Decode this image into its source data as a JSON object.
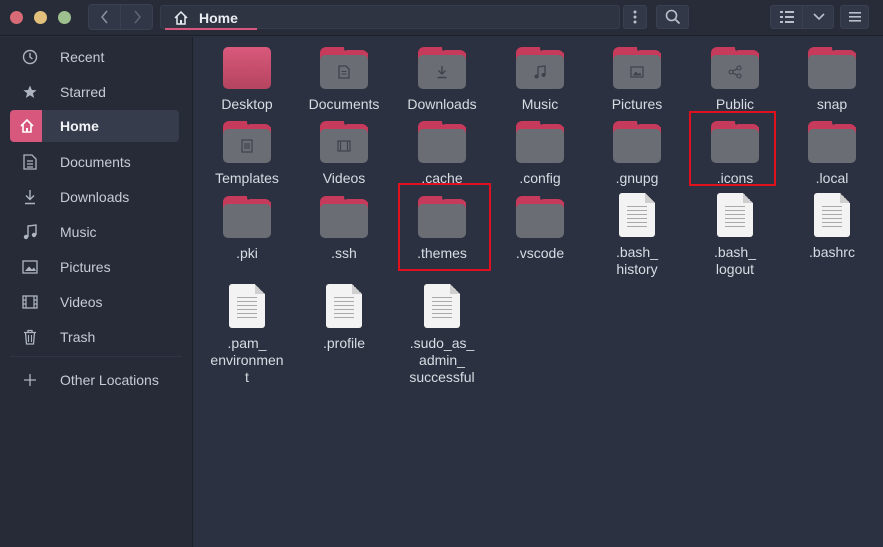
{
  "header": {
    "path_label": "Home",
    "icons": {
      "back": "chevron-left-icon",
      "forward": "chevron-right-icon",
      "home": "home-icon",
      "menu": "kebab-menu-icon",
      "search": "search-icon",
      "view": "list-view-icon",
      "view_options": "chevron-down-icon",
      "main_menu": "hamburger-icon"
    }
  },
  "sidebar": {
    "items": [
      {
        "label": "Recent",
        "icon": "clock-icon"
      },
      {
        "label": "Starred",
        "icon": "star-icon"
      },
      {
        "label": "Home",
        "icon": "home-icon",
        "active": true
      },
      {
        "label": "Documents",
        "icon": "document-icon"
      },
      {
        "label": "Downloads",
        "icon": "download-icon"
      },
      {
        "label": "Music",
        "icon": "music-icon"
      },
      {
        "label": "Pictures",
        "icon": "picture-icon"
      },
      {
        "label": "Videos",
        "icon": "film-icon"
      },
      {
        "label": "Trash",
        "icon": "trash-icon"
      },
      {
        "label": "Other Locations",
        "icon": "plus-icon"
      }
    ]
  },
  "files": [
    {
      "name": "Desktop",
      "kind": "folder"
    },
    {
      "name": "Documents",
      "kind": "folder",
      "emblem": "document-icon"
    },
    {
      "name": "Downloads",
      "kind": "folder",
      "emblem": "download-icon"
    },
    {
      "name": "Music",
      "kind": "folder",
      "emblem": "music-icon"
    },
    {
      "name": "Pictures",
      "kind": "folder",
      "emblem": "picture-icon"
    },
    {
      "name": "Public",
      "kind": "folder",
      "emblem": "share-icon"
    },
    {
      "name": "snap",
      "kind": "folder"
    },
    {
      "name": "Templates",
      "kind": "folder",
      "emblem": "template-icon"
    },
    {
      "name": "Videos",
      "kind": "folder",
      "emblem": "film-icon"
    },
    {
      "name": ".cache",
      "kind": "folder"
    },
    {
      "name": ".config",
      "kind": "folder"
    },
    {
      "name": ".gnupg",
      "kind": "folder"
    },
    {
      "name": ".icons",
      "kind": "folder",
      "highlighted": true
    },
    {
      "name": ".local",
      "kind": "folder"
    },
    {
      "name": ".pki",
      "kind": "folder"
    },
    {
      "name": ".ssh",
      "kind": "folder"
    },
    {
      "name": ".themes",
      "kind": "folder",
      "highlighted": true
    },
    {
      "name": ".vscode",
      "kind": "folder"
    },
    {
      "name": ".bash_\nhistory",
      "kind": "file"
    },
    {
      "name": ".bash_\nlogout",
      "kind": "file"
    },
    {
      "name": ".bashrc",
      "kind": "file"
    },
    {
      "name": ".pam_\nenvironmen\nt",
      "kind": "file"
    },
    {
      "name": ".profile",
      "kind": "file"
    },
    {
      "name": ".sudo_as_\nadmin_\nsuccessful",
      "kind": "file"
    }
  ],
  "colors": {
    "accent": "#d8577d",
    "folder_tab": "#c63a5c",
    "folder_body": "#6b6d75",
    "highlight_box": "#e0101e",
    "background": "#2b3140"
  }
}
